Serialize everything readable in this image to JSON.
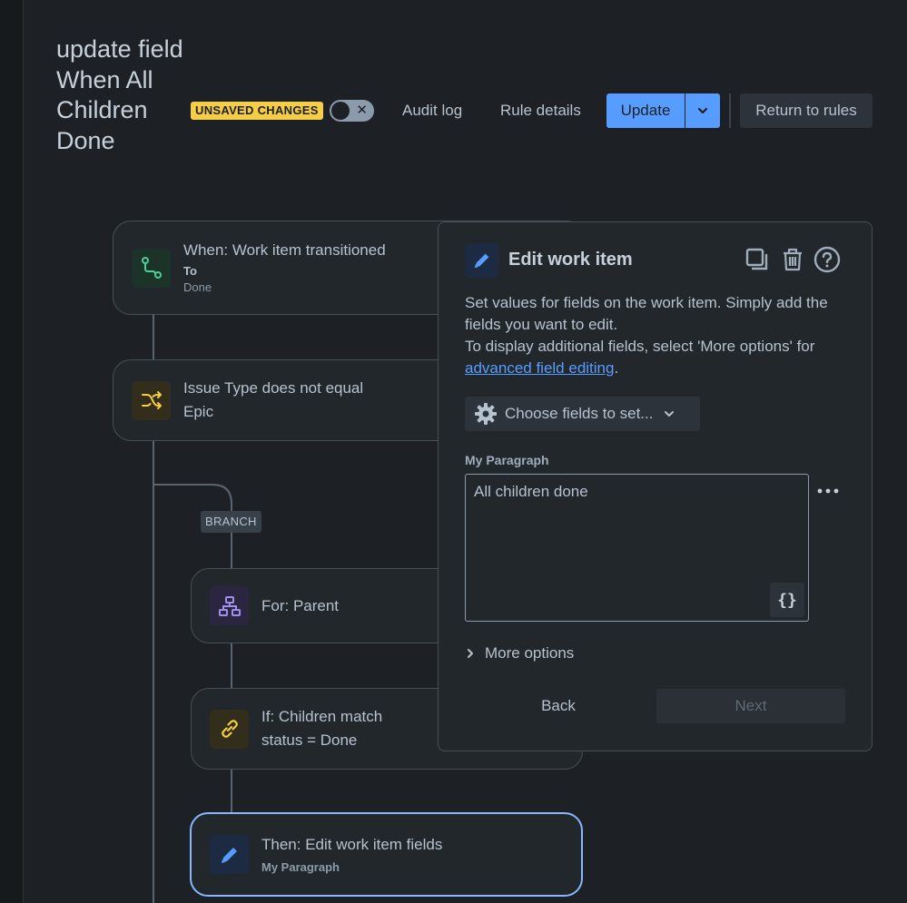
{
  "header": {
    "title": "update field When All Children Done",
    "unsaved_badge": "UNSAVED CHANGES",
    "toggle_state": "off",
    "audit_log": "Audit log",
    "rule_details": "Rule details",
    "update": "Update",
    "return_to_rules": "Return to rules"
  },
  "flow": {
    "trigger": {
      "title": "When: Work item transitioned",
      "sub_label": "To",
      "sub_value": "Done",
      "icon": "transition-icon"
    },
    "condition": {
      "line1": "Issue Type does not equal",
      "line2": "Epic",
      "icon": "shuffle-icon"
    },
    "branch_label": "BRANCH",
    "branch_for": {
      "title": "For: Parent",
      "icon": "hierarchy-icon"
    },
    "if_children": {
      "line1": "If: Children match",
      "line2": "status = Done",
      "icon": "link-icon"
    },
    "then_edit": {
      "title": "Then: Edit work item fields",
      "sub": "My Paragraph",
      "icon": "pencil-icon"
    }
  },
  "panel": {
    "title": "Edit work item",
    "desc1": "Set values for fields on the work item. Simply add the fields you want to edit.",
    "desc2": "To display additional fields, select 'More options' for",
    "link": "advanced field editing",
    "link_suffix": ".",
    "choose_fields": "Choose fields to set...",
    "field_label": "My Paragraph",
    "field_value": "All children done",
    "more_options": "More options",
    "back": "Back",
    "next": "Next"
  },
  "colors": {
    "background": "#1d2125",
    "accent": "#579dff",
    "badge": "#f5cd47",
    "selected_border": "#85b8ff"
  }
}
